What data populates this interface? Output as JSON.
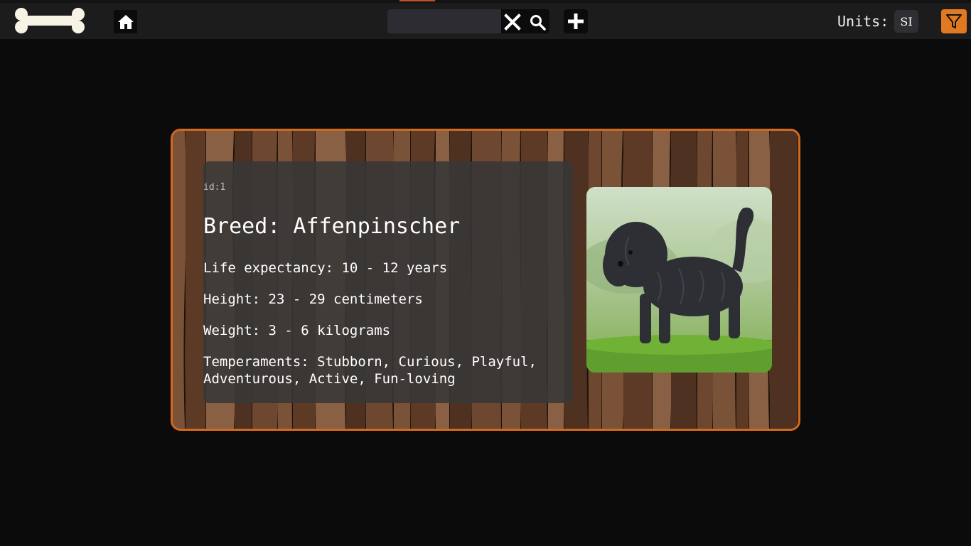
{
  "header": {
    "logo": "bone-logo",
    "home_icon": "home-icon",
    "search": {
      "value": "",
      "placeholder": ""
    },
    "clear_icon": "close-icon",
    "search_icon": "search-icon",
    "add_icon": "plus-icon",
    "units_label": "Units:",
    "units_value": "SI",
    "filter_icon": "filter-icon"
  },
  "colors": {
    "accent": "#e07a22",
    "card_border": "#d26a1c",
    "background": "#0b0b0c",
    "topbar": "#1c1c1d"
  },
  "card": {
    "id_text": "id:1",
    "breed_text": "Breed: Affenpinscher",
    "life_text": "Life expectancy: 10 - 12 years",
    "height_text": "Height: 23 - 29 centimeters",
    "weight_text": "Weight: 3 - 6 kilograms",
    "temperaments_line1": "Temperaments: Stubborn, Curious, Playful,",
    "temperaments_line2": "Adventurous, Active, Fun-loving",
    "image": "dog-photo"
  }
}
